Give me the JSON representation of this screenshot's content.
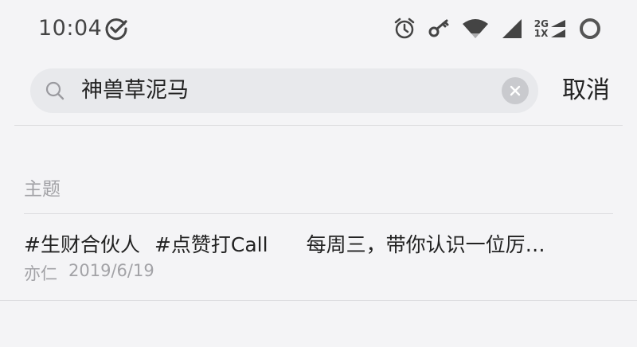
{
  "status_bar": {
    "time": "10:04",
    "network_top": "2G",
    "network_bottom": "1X",
    "icons": [
      "check-circle-icon",
      "alarm-icon",
      "key-icon",
      "wifi-icon",
      "signal-icon",
      "signal-2g-icon",
      "battery-ring-icon"
    ]
  },
  "search": {
    "query": "神兽草泥马",
    "cancel_label": "取消"
  },
  "section": {
    "title": "主题"
  },
  "results": [
    {
      "tags": [
        "#生财合伙人",
        "#点赞打Call"
      ],
      "description": "每周三，带你认识一位厉…",
      "author": "亦仁",
      "date": "2019/6/19"
    }
  ],
  "colors": {
    "background": "#f4f4f6",
    "search_box": "#e8e9ec",
    "muted_text": "#a2a2a6",
    "primary_text": "#222222"
  }
}
